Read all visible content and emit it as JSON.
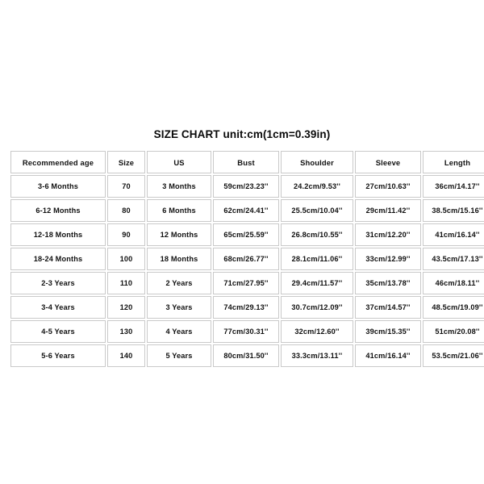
{
  "title": "SIZE CHART unit:cm(1cm=0.39in)",
  "table": {
    "headers": [
      "Recommended age",
      "Size",
      "US",
      "Bust",
      "Shoulder",
      "Sleeve",
      "Length"
    ],
    "rows": [
      [
        "3-6 Months",
        "70",
        "3 Months",
        "59cm/23.23''",
        "24.2cm/9.53''",
        "27cm/10.63''",
        "36cm/14.17''"
      ],
      [
        "6-12 Months",
        "80",
        "6 Months",
        "62cm/24.41''",
        "25.5cm/10.04''",
        "29cm/11.42''",
        "38.5cm/15.16''"
      ],
      [
        "12-18 Months",
        "90",
        "12 Months",
        "65cm/25.59''",
        "26.8cm/10.55''",
        "31cm/12.20''",
        "41cm/16.14''"
      ],
      [
        "18-24 Months",
        "100",
        "18 Months",
        "68cm/26.77''",
        "28.1cm/11.06''",
        "33cm/12.99''",
        "43.5cm/17.13''"
      ],
      [
        "2-3 Years",
        "110",
        "2 Years",
        "71cm/27.95''",
        "29.4cm/11.57''",
        "35cm/13.78''",
        "46cm/18.11''"
      ],
      [
        "3-4 Years",
        "120",
        "3 Years",
        "74cm/29.13''",
        "30.7cm/12.09''",
        "37cm/14.57''",
        "48.5cm/19.09''"
      ],
      [
        "4-5 Years",
        "130",
        "4 Years",
        "77cm/30.31''",
        "32cm/12.60''",
        "39cm/15.35''",
        "51cm/20.08''"
      ],
      [
        "5-6 Years",
        "140",
        "5 Years",
        "80cm/31.50''",
        "33.3cm/13.11''",
        "41cm/16.14''",
        "53.5cm/21.06''"
      ]
    ]
  },
  "chart_data": {
    "type": "table",
    "title": "SIZE CHART unit:cm(1cm=0.39in)",
    "columns": [
      "Recommended age",
      "Size",
      "US",
      "Bust",
      "Shoulder",
      "Sleeve",
      "Length"
    ],
    "units": "cm / inches",
    "rows": [
      {
        "recommended_age": "3-6 Months",
        "size": 70,
        "us": "3 Months",
        "bust_cm": 59,
        "bust_in": 23.23,
        "shoulder_cm": 24.2,
        "shoulder_in": 9.53,
        "sleeve_cm": 27,
        "sleeve_in": 10.63,
        "length_cm": 36,
        "length_in": 14.17
      },
      {
        "recommended_age": "6-12 Months",
        "size": 80,
        "us": "6 Months",
        "bust_cm": 62,
        "bust_in": 24.41,
        "shoulder_cm": 25.5,
        "shoulder_in": 10.04,
        "sleeve_cm": 29,
        "sleeve_in": 11.42,
        "length_cm": 38.5,
        "length_in": 15.16
      },
      {
        "recommended_age": "12-18 Months",
        "size": 90,
        "us": "12 Months",
        "bust_cm": 65,
        "bust_in": 25.59,
        "shoulder_cm": 26.8,
        "shoulder_in": 10.55,
        "sleeve_cm": 31,
        "sleeve_in": 12.2,
        "length_cm": 41,
        "length_in": 16.14
      },
      {
        "recommended_age": "18-24 Months",
        "size": 100,
        "us": "18 Months",
        "bust_cm": 68,
        "bust_in": 26.77,
        "shoulder_cm": 28.1,
        "shoulder_in": 11.06,
        "sleeve_cm": 33,
        "sleeve_in": 12.99,
        "length_cm": 43.5,
        "length_in": 17.13
      },
      {
        "recommended_age": "2-3 Years",
        "size": 110,
        "us": "2 Years",
        "bust_cm": 71,
        "bust_in": 27.95,
        "shoulder_cm": 29.4,
        "shoulder_in": 11.57,
        "sleeve_cm": 35,
        "sleeve_in": 13.78,
        "length_cm": 46,
        "length_in": 18.11
      },
      {
        "recommended_age": "3-4 Years",
        "size": 120,
        "us": "3 Years",
        "bust_cm": 74,
        "bust_in": 29.13,
        "shoulder_cm": 30.7,
        "shoulder_in": 12.09,
        "sleeve_cm": 37,
        "sleeve_in": 14.57,
        "length_cm": 48.5,
        "length_in": 19.09
      },
      {
        "recommended_age": "4-5 Years",
        "size": 130,
        "us": "4 Years",
        "bust_cm": 77,
        "bust_in": 30.31,
        "shoulder_cm": 32,
        "shoulder_in": 12.6,
        "sleeve_cm": 39,
        "sleeve_in": 15.35,
        "length_cm": 51,
        "length_in": 20.08
      },
      {
        "recommended_age": "5-6 Years",
        "size": 140,
        "us": "5 Years",
        "bust_cm": 80,
        "bust_in": 31.5,
        "shoulder_cm": 33.3,
        "shoulder_in": 13.11,
        "sleeve_cm": 41,
        "sleeve_in": 16.14,
        "length_cm": 53.5,
        "length_in": 21.06
      }
    ]
  }
}
